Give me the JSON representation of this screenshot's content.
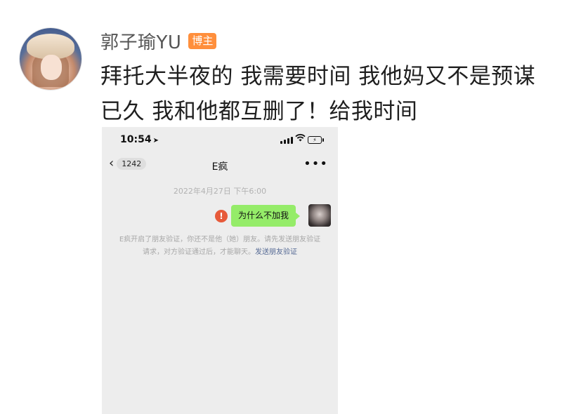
{
  "post": {
    "username": "郭子瑜YU",
    "badge": "博主",
    "text_lines": [
      "拜托大半夜的 我需要时间 我他妈又不是预谋",
      "已久 我和他都互删了！给我时间"
    ]
  },
  "screenshot": {
    "status_bar": {
      "time": "10:54"
    },
    "nav": {
      "back_count": "1242",
      "title": "E疯",
      "more": "•••"
    },
    "timestamp": "2022年4月27日 下午6:00",
    "message": {
      "text": "为什么不加我",
      "status_icon": "!"
    },
    "system_notice": {
      "text": "E疯开启了朋友验证，你还不是他（她）朋友。请先发送朋友验证请求，对方验证通过后，才能聊天。",
      "link": "发送朋友验证"
    }
  },
  "icons": {
    "location": "location-arrow-icon",
    "wifi": "wifi-icon",
    "battery": "battery-charging-icon",
    "back": "chevron-left-icon",
    "more": "more-dots-icon",
    "error": "error-exclamation-icon"
  },
  "colors": {
    "badge": "#ff8f3c",
    "bubble": "#95ec69",
    "error": "#e75a3a",
    "link": "#576b95",
    "chat_bg": "#ededed"
  }
}
